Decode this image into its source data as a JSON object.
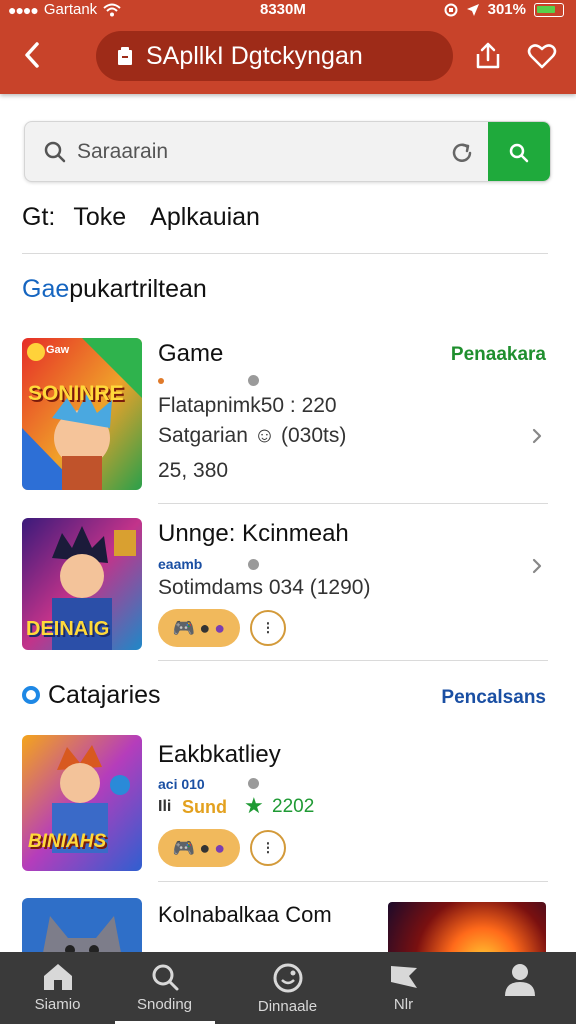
{
  "status_bar": {
    "carrier": "Gartank",
    "time": "8330M",
    "battery": "301%"
  },
  "header": {
    "title": "SApllkI Dgtckyngan"
  },
  "search": {
    "placeholder": "Saraarain"
  },
  "tabs": [
    "Gt:",
    "Toke",
    "Aplkauian"
  ],
  "section1": {
    "title_accent": "Gae",
    "title_rest": "pukartriltean"
  },
  "apps": [
    {
      "name": "Game",
      "status": "Penaakara",
      "line1": "Flatapnimk50 : 220",
      "line2": "Satgarian ☺ (030ts)",
      "line3": "25, 380",
      "thumb_label": "SONINRE",
      "thumb_badge": "Gaw"
    },
    {
      "name": "Unnge: Kcinmeah",
      "small": "eaamb",
      "line1": "Sotimdams 034 (1290)",
      "thumb_label": "DEINAIG"
    }
  ],
  "section2": {
    "title": "Catajaries",
    "link": "Pencalsans"
  },
  "categories": [
    {
      "name": "Eakbkatliey",
      "small": "aci 010",
      "sound": "Sund",
      "rating": "2202",
      "thumb_label": "BINIAHS"
    },
    {
      "name": "Kolnabalkaa Com"
    }
  ],
  "bottom_nav": [
    {
      "label": "Siamio",
      "icon": "home-icon"
    },
    {
      "label": "Snoding",
      "icon": "search-icon"
    },
    {
      "label": "Dinnaale",
      "icon": "smile-icon"
    },
    {
      "label": "Nlr",
      "icon": "flag-icon"
    },
    {
      "label": "",
      "icon": "profile-icon"
    }
  ],
  "colors": {
    "header": "#c8432a",
    "pill": "#9e2b18",
    "search_button": "#1faa3c",
    "accent_blue": "#1565c0",
    "status_green": "#1f8f2e",
    "chip": "#f1b95c",
    "bottom_nav": "#3a3a3a"
  }
}
